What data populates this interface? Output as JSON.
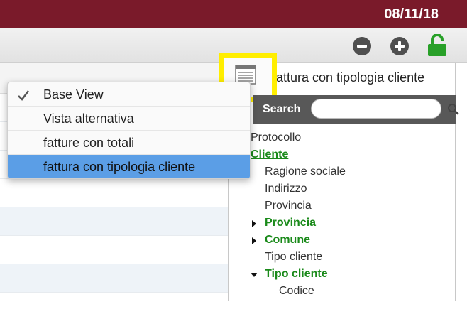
{
  "header": {
    "date": "08/11/18"
  },
  "toolbar": {
    "icons": [
      "minus-circle-icon",
      "plus-circle-icon",
      "unlock-icon"
    ],
    "colors": {
      "header_bg": "#7a1a2a",
      "lock": "#28a028",
      "highlight": "#ffee00",
      "menu_selected": "#5b9ee6",
      "link": "#1a8a1a"
    }
  },
  "view": {
    "current_title": "fattura con tipologia cliente",
    "menu": [
      {
        "label": "Base View",
        "checked": true,
        "selected": false
      },
      {
        "label": "Vista alternativa",
        "checked": false,
        "selected": false
      },
      {
        "label": "fatture con totali",
        "checked": false,
        "selected": false
      },
      {
        "label": "fattura con tipologia cliente",
        "checked": false,
        "selected": true
      }
    ]
  },
  "search": {
    "label": "Search",
    "value": "",
    "placeholder": ""
  },
  "tree": [
    {
      "label": "Protocollo",
      "link": false
    },
    {
      "label": "Cliente",
      "link": true
    },
    {
      "label": "Ragione sociale",
      "link": false
    },
    {
      "label": "Indirizzo",
      "link": false
    },
    {
      "label": "Provincia",
      "link": false
    },
    {
      "label": "Provincia",
      "link": true,
      "arrow": "right"
    },
    {
      "label": "Comune",
      "link": true,
      "arrow": "right"
    },
    {
      "label": "Tipo cliente",
      "link": false
    },
    {
      "label": "Tipo cliente",
      "link": true,
      "arrow": "down"
    },
    {
      "label": "Codice",
      "link": false
    }
  ]
}
